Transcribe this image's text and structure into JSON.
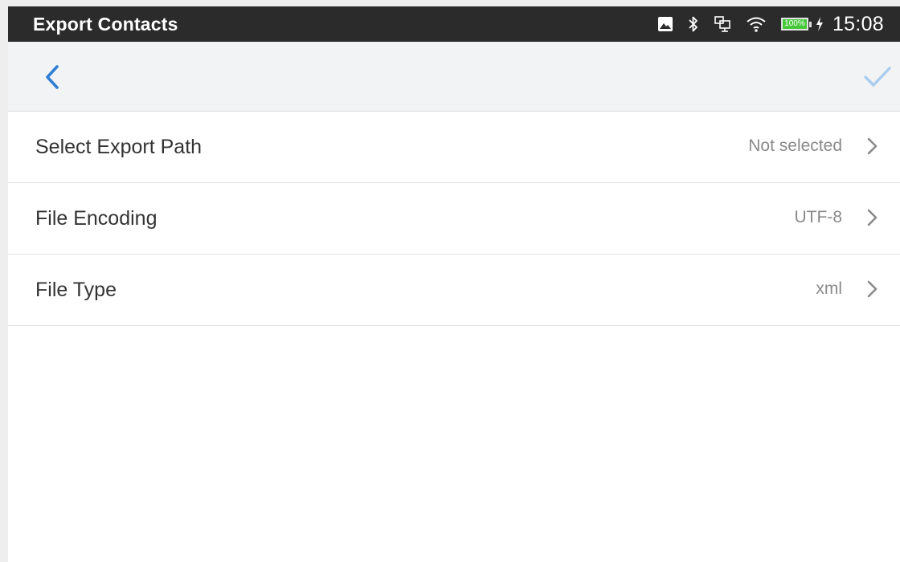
{
  "status_bar": {
    "title": "Export Contacts",
    "battery_text": "100%",
    "battery_level": 1.0,
    "time": "15:08",
    "icons": [
      "image-icon",
      "bluetooth-icon",
      "network-icon",
      "wifi-icon",
      "battery-icon",
      "charging-icon"
    ]
  },
  "action_bar": {
    "back_icon": "chevron-left-icon",
    "confirm_icon": "checkmark-icon",
    "accent_color": "#2f7fd6",
    "confirm_color": "#a9cdee"
  },
  "settings": [
    {
      "label": "Select Export Path",
      "value": "Not selected"
    },
    {
      "label": "File Encoding",
      "value": "UTF-8"
    },
    {
      "label": "File Type",
      "value": "xml"
    }
  ]
}
